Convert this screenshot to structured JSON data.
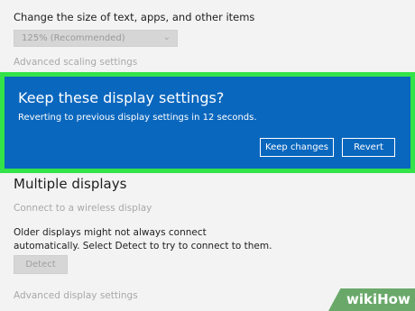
{
  "settings": {
    "scale_label": "Change the size of text, apps, and other items",
    "scale_value": "125% (Recommended)",
    "advanced_scaling": "Advanced scaling settings",
    "multiple_displays_title": "Multiple displays",
    "connect_wireless": "Connect to a wireless display",
    "older_displays_text": "Older displays might not always connect automatically. Select Detect to try to connect to them.",
    "detect_button": "Detect",
    "advanced_display": "Advanced display settings"
  },
  "dialog": {
    "title": "Keep these display settings?",
    "message": "Reverting to previous display settings in 12 seconds.",
    "keep_button": "Keep changes",
    "revert_button": "Revert"
  },
  "watermark": {
    "text": "wikiHow"
  },
  "colors": {
    "dialog_bg": "#0a67be",
    "highlight_frame": "#34e34a",
    "page_bg": "#f3f3f3"
  },
  "icons": {
    "select_chevron": "chevron-down-icon"
  }
}
